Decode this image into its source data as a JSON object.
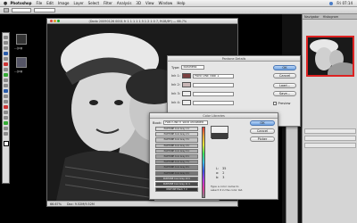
{
  "menubar": {
    "apple": "",
    "menus": [
      "Photoshop",
      "File",
      "Edit",
      "Image",
      "Layer",
      "Select",
      "Filter",
      "Analysis",
      "3D",
      "View",
      "Window",
      "Help"
    ],
    "time": "Fri 07:14",
    "colors": {
      "accent": "#4a7dc7"
    }
  },
  "desktop": {
    "labels": [
      "...jpg",
      "...jpg"
    ]
  },
  "document": {
    "title": "(Dodo 20090126 0001 fr 1 1 1 1 1 5 1 2 1 0 7, RGB/8*) — 66.7%",
    "status": [
      "66.67%",
      "Doc: 9.52M/9.52M"
    ]
  },
  "pantone_dialog": {
    "title": "Pantone Details",
    "type_label": "Type:",
    "type_value": "Business",
    "ink1_label": "Ink 1:",
    "ink1_value": "PANTONE cool 1",
    "ink2_label": "Ink 2:",
    "ink3_label": "Ink 3:",
    "ink4_label": "Ink 4:",
    "buttons": [
      "OK",
      "Cancel",
      "Load...",
      "Save...",
      "Preview"
    ],
    "colors": {
      "ink1": "#7a4040",
      "ink2": "#c9b7b7"
    }
  },
  "color_libraries": {
    "title": "Color Libraries",
    "book_label": "Book:",
    "book_value": "PANTONE® solid uncoated",
    "swatches": [
      {
        "name": "PANTONE Cool Gray 1 U",
        "color": "#d8d8d8"
      },
      {
        "name": "PANTONE Cool Gray 2 U",
        "color": "#cfcfcf"
      },
      {
        "name": "PANTONE Cool Gray 3 U",
        "color": "#c4c4c4"
      },
      {
        "name": "PANTONE Cool Gray 4 U",
        "color": "#b8b8b8"
      },
      {
        "name": "PANTONE Cool Gray 5 U",
        "color": "#acacac"
      },
      {
        "name": "PANTONE Cool Gray 6 U",
        "color": "#a0a0a0"
      },
      {
        "name": "PANTONE Cool Gray 7 U",
        "color": "#929292"
      },
      {
        "name": "PANTONE Cool Gray 8 U",
        "color": "#848484"
      },
      {
        "name": "PANTONE Cool Gray 9 U",
        "color": "#747474"
      },
      {
        "name": "PANTONE Cool Gray 10 U",
        "color": "#5e5e5e"
      },
      {
        "name": "PANTONE Cool Gray 11 U",
        "color": "#4a4a4a"
      },
      {
        "name": "PANTONE Black 7 U",
        "color": "#333333"
      }
    ],
    "buttons": [
      "OK",
      "Cancel",
      "Picker"
    ],
    "lab": [
      {
        "k": "L:",
        "v": "35"
      },
      {
        "k": "a:",
        "v": "2"
      },
      {
        "k": "b:",
        "v": "3"
      }
    ],
    "hint": "Type a color name to select it in the color list."
  },
  "panels": {
    "tabs": [
      "Navigator",
      "Histogram"
    ],
    "layers_tab": "Layers"
  }
}
